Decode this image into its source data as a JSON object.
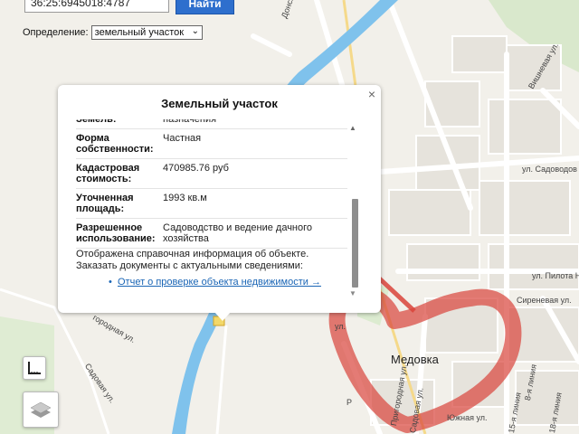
{
  "search": {
    "value": "36:25:6945018:4787",
    "find_label": "Найти"
  },
  "definition": {
    "label": "Определение:",
    "selected": "земельный участок"
  },
  "popup": {
    "title": "Земельный участок",
    "close_symbol": "×",
    "rows": [
      {
        "key": "Земель:",
        "value": "назначения"
      },
      {
        "key": "Форма собственности:",
        "value": "Частная"
      },
      {
        "key": "Кадастровая стоимость:",
        "value": "470985.76 руб"
      },
      {
        "key": "Уточненная площадь:",
        "value": "1993 кв.м"
      },
      {
        "key": "Разрешенное использование:",
        "value": "Садоводство и ведение дачного хозяйства"
      }
    ],
    "note_line1": "Отображена справочная информация об объекте.",
    "note_line2": "Заказать документы с актуальными сведениями:",
    "report_link": "Отчет о проверке объекта недвижимости →"
  },
  "map": {
    "labels": {
      "donskaya": "Донская ул.",
      "vishnevaya": "Вишневая ул.",
      "sadovodov": "ул. Садоводов",
      "pilota": "ул. Пилота Не",
      "sirenevaya": "Сиреневая ул.",
      "medovka": "Медовка",
      "yuzhnaya": "Южная ул.",
      "sadovaya": "Садовая ул.",
      "prigorodnaya": "Пригородная ул.",
      "liniya8": "8-я линия",
      "liniya15": "15-я линия",
      "liniya18": "18-я линия",
      "ulFragment": "ул.",
      "rFragment": "Р",
      "sadovayaLeft": "Садовая ул.",
      "gorodnayaLeft": "городная ул."
    },
    "colors": {
      "river": "#7fc2ec",
      "annotation_red": "#d9433a",
      "road": "#ffffff",
      "block": "#e4e2dc"
    }
  },
  "controls": {
    "ruler_icon": "ruler-icon",
    "layers_icon": "layers-icon"
  }
}
